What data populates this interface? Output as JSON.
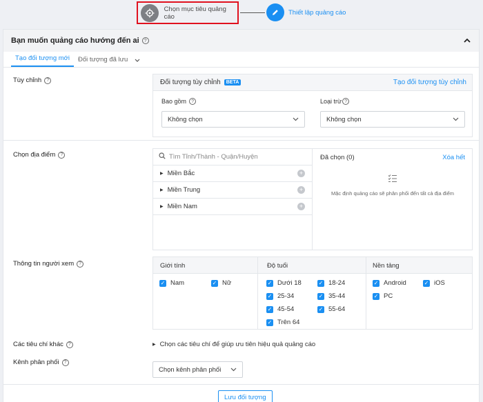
{
  "stepper": {
    "step1_label": "Chọn mục tiêu quảng cáo",
    "step2_label": "Thiết lập quảng cáo"
  },
  "panel": {
    "title": "Bạn muốn quảng cáo hướng đến ai",
    "tabs": [
      {
        "label": "Tạo đối tượng mới"
      },
      {
        "label": "Đối tượng đã lưu"
      }
    ]
  },
  "custom": {
    "label": "Tùy chỉnh",
    "box_title": "Đối tượng tùy chỉnh",
    "beta": "BETA",
    "create_link": "Tạo đối tượng tùy chỉnh",
    "include_label": "Bao gồm",
    "include_value": "Không chọn",
    "exclude_label": "Loại trừ",
    "exclude_value": "Không chọn"
  },
  "location": {
    "label": "Chọn địa điểm",
    "search_placeholder": "Tìm Tỉnh/Thành - Quận/Huyện",
    "regions": [
      "Miền Bắc",
      "Miền Trung",
      "Miền Nam"
    ],
    "selected_title": "Đã chọn (0)",
    "clear_all": "Xóa hết",
    "empty_note": "Mặc định quảng cáo sẽ phân phối đến tất cả địa điểm"
  },
  "viewer": {
    "label": "Thông tin người xem",
    "gender_title": "Giới tính",
    "genders": [
      "Nam",
      "Nữ"
    ],
    "age_title": "Độ tuổi",
    "ages": [
      "Dưới 18",
      "18-24",
      "25-34",
      "35-44",
      "45-54",
      "55-64",
      "Trên 64"
    ],
    "platform_title": "Nền tảng",
    "platforms": [
      "Android",
      "iOS",
      "PC"
    ]
  },
  "other": {
    "label": "Các tiêu chí khác",
    "text": "Chọn các tiêu chí để giúp ưu tiên hiệu quả quảng cáo"
  },
  "channel": {
    "label": "Kênh phân phối",
    "value": "Chọn kênh phân phối"
  },
  "footer": {
    "save_label": "Lưu đối tượng"
  },
  "colors": {
    "accent": "#1a8ff2",
    "highlight_border": "#e0101e"
  }
}
